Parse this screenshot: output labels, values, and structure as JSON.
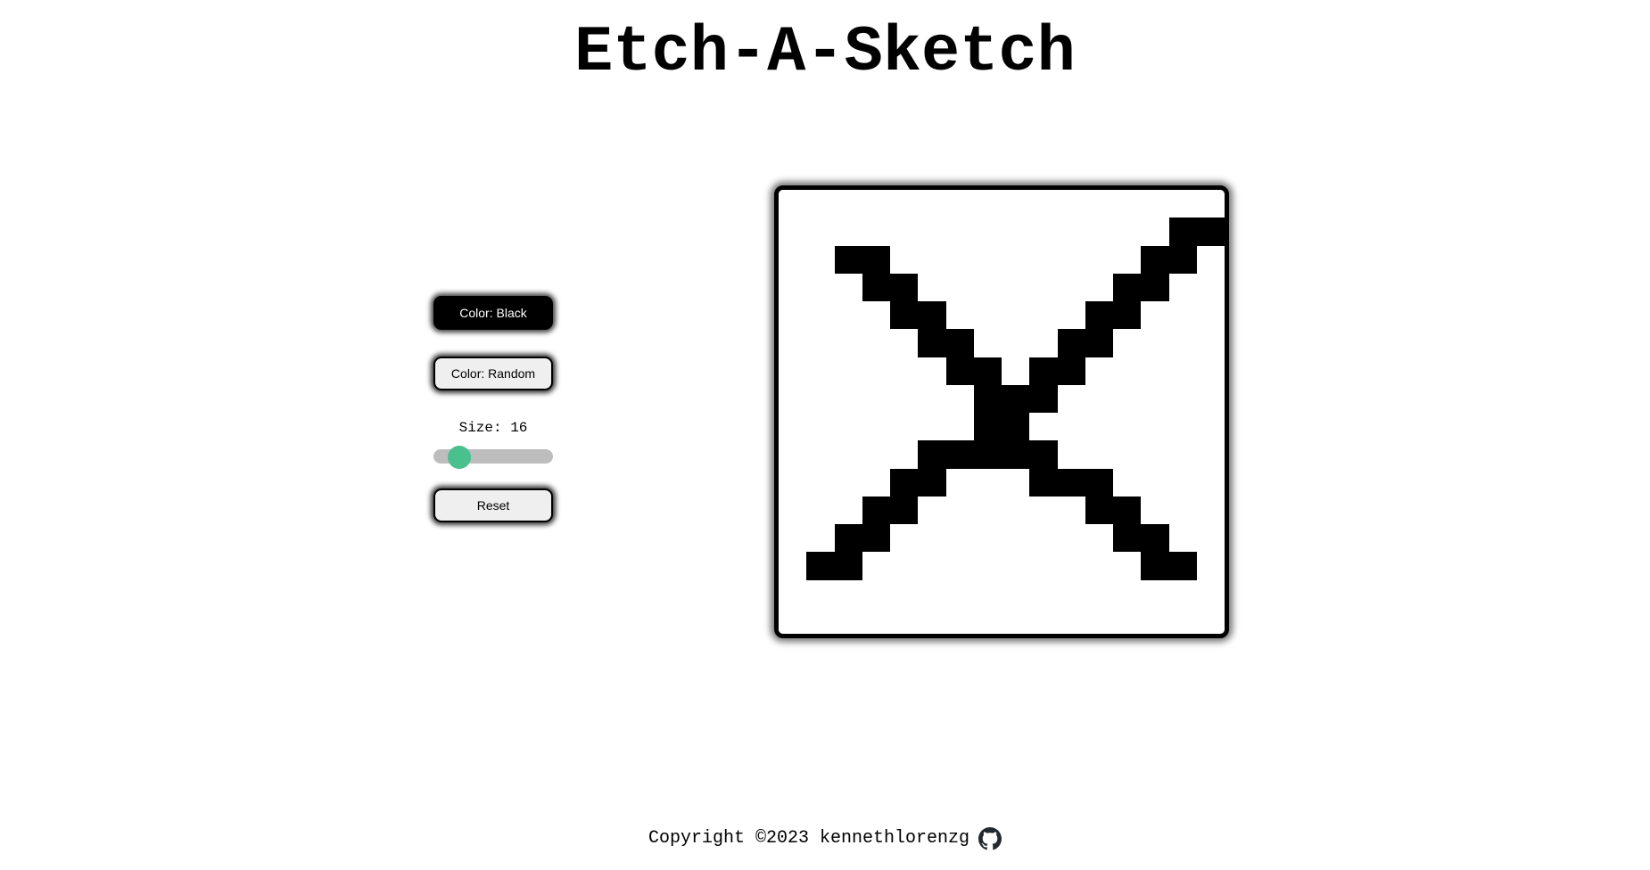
{
  "page": {
    "title": "Etch-A-Sketch"
  },
  "controls": {
    "color_black_label": "Color: Black",
    "color_random_label": "Color: Random",
    "size_label": "Size: 16",
    "size_value": 16,
    "size_min": 1,
    "size_max": 100,
    "reset_label": "Reset"
  },
  "board": {
    "grid_size": 16,
    "pen_color": "#000000",
    "background_color": "#ffffff",
    "filled_cells": [
      [
        14,
        1
      ],
      [
        15,
        1
      ],
      [
        2,
        2
      ],
      [
        3,
        2
      ],
      [
        13,
        2
      ],
      [
        14,
        2
      ],
      [
        3,
        3
      ],
      [
        4,
        3
      ],
      [
        12,
        3
      ],
      [
        13,
        3
      ],
      [
        4,
        4
      ],
      [
        5,
        4
      ],
      [
        11,
        4
      ],
      [
        12,
        4
      ],
      [
        5,
        5
      ],
      [
        6,
        5
      ],
      [
        10,
        5
      ],
      [
        11,
        5
      ],
      [
        6,
        6
      ],
      [
        7,
        6
      ],
      [
        9,
        6
      ],
      [
        10,
        6
      ],
      [
        7,
        7
      ],
      [
        8,
        7
      ],
      [
        9,
        7
      ],
      [
        7,
        8
      ],
      [
        8,
        8
      ],
      [
        5,
        9
      ],
      [
        6,
        9
      ],
      [
        7,
        9
      ],
      [
        8,
        9
      ],
      [
        9,
        9
      ],
      [
        4,
        10
      ],
      [
        5,
        10
      ],
      [
        9,
        10
      ],
      [
        10,
        10
      ],
      [
        11,
        10
      ],
      [
        3,
        11
      ],
      [
        4,
        11
      ],
      [
        11,
        11
      ],
      [
        12,
        11
      ],
      [
        2,
        12
      ],
      [
        3,
        12
      ],
      [
        12,
        12
      ],
      [
        13,
        12
      ],
      [
        1,
        13
      ],
      [
        2,
        13
      ],
      [
        13,
        13
      ],
      [
        14,
        13
      ]
    ]
  },
  "footer": {
    "copyright": "Copyright ©2023 kennethlorenzg",
    "icon": "github-icon"
  },
  "colors": {
    "accent": "#4bc08f",
    "slider_track": "#bdbdbd"
  }
}
